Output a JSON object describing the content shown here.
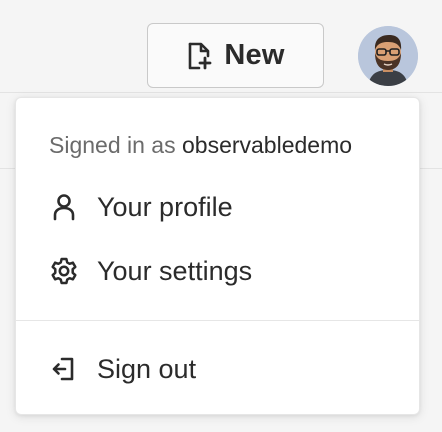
{
  "toolbar": {
    "new_label": "New",
    "new_icon": "new-document-icon"
  },
  "user": {
    "avatar_icon": "user-avatar",
    "avatar_bg": "#b9c6dc"
  },
  "menu": {
    "signed_in_prefix": "Signed in as",
    "username": "observabledemo",
    "items": [
      {
        "label": "Your profile",
        "icon": "person-icon"
      },
      {
        "label": "Your settings",
        "icon": "gear-icon"
      },
      {
        "label": "Sign out",
        "icon": "sign-out-icon"
      }
    ]
  },
  "colors": {
    "text": "#2b2b2b",
    "muted_text": "#6b6b6b",
    "menu_bg": "#ffffff",
    "page_bg": "#f5f5f5"
  }
}
